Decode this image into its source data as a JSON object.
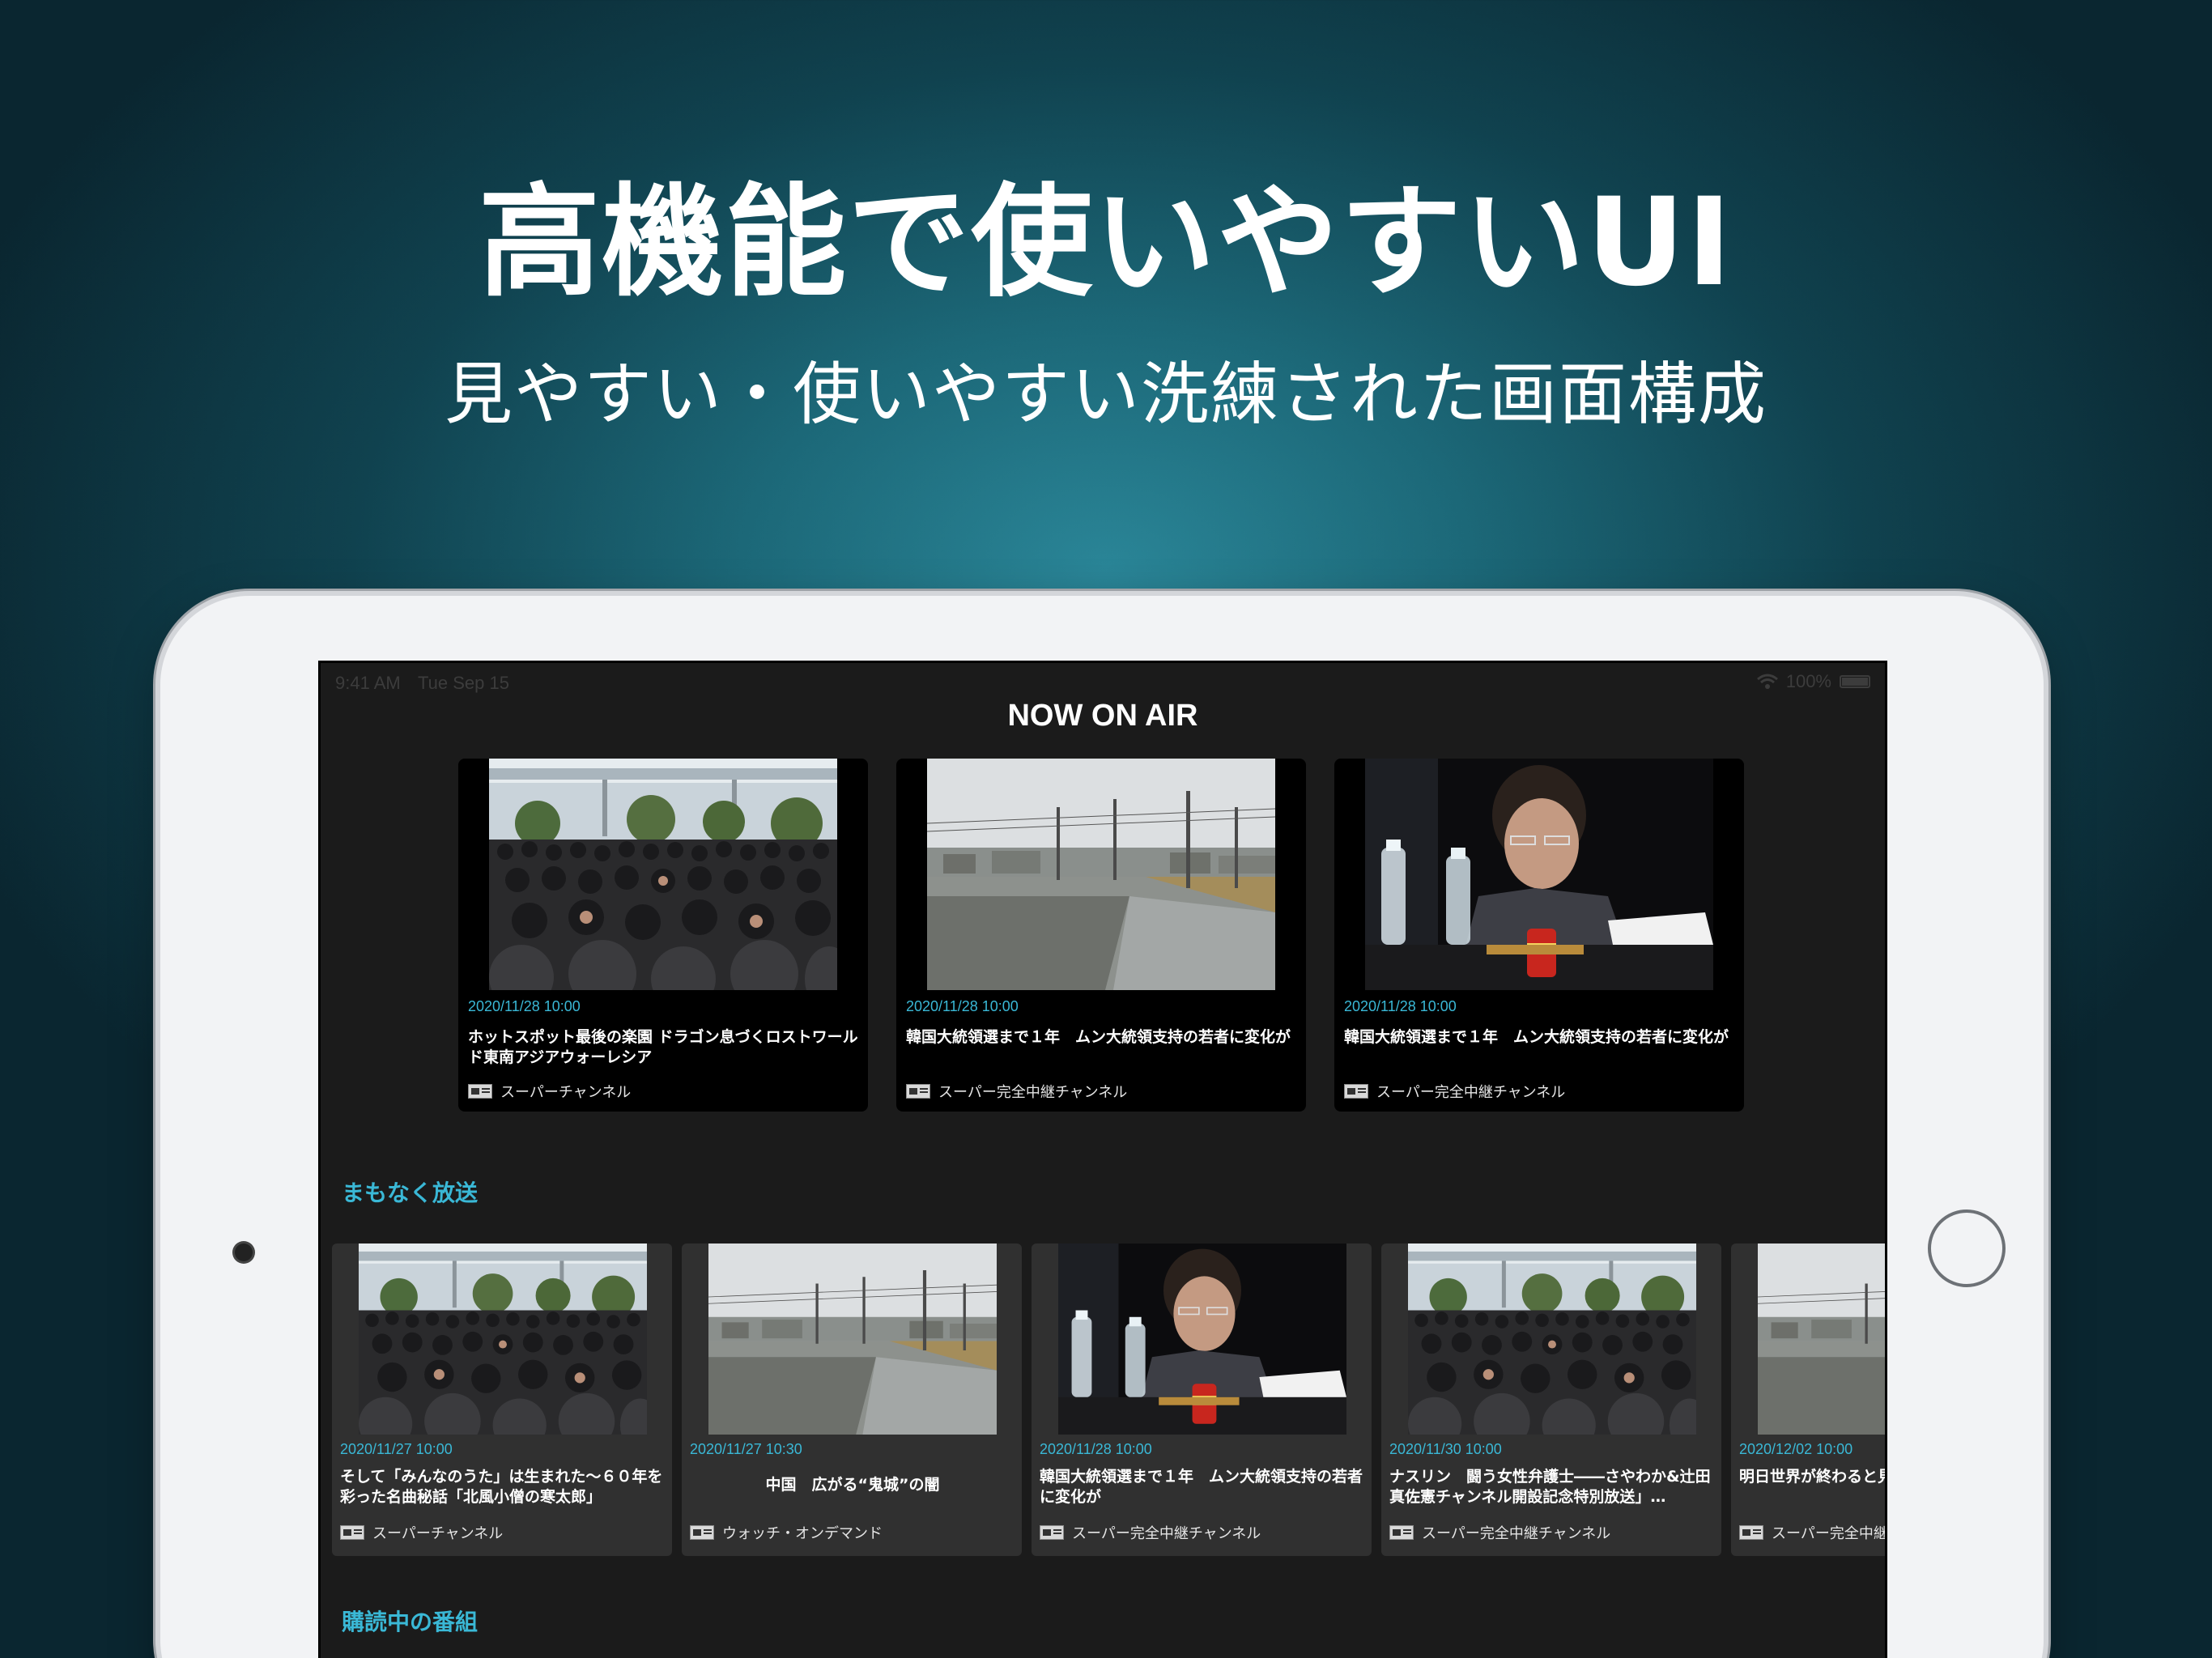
{
  "headline": "高機能で使いやすいUI",
  "subheadline": "見やすい・使いやすい洗練された画面構成",
  "status_bar": {
    "time": "9:41 AM",
    "date": "Tue Sep 15",
    "battery": "100%"
  },
  "screen_title": "NOW ON AIR",
  "now_on_air": [
    {
      "date": "2020/11/28 10:00",
      "title": "ホットスポット最後の楽園 ドラゴン息づくロストワールド東南アジアウォーレシア",
      "channel": "スーパーチャンネル",
      "image": "crowd"
    },
    {
      "date": "2020/11/28 10:00",
      "title": "韓国大統領選まで１年　ムン大統領支持の若者に変化が",
      "channel": "スーパー完全中継チャンネル",
      "image": "flooded-town"
    },
    {
      "date": "2020/11/28 10:00",
      "title": "韓国大統領選まで１年　ムン大統領支持の若者に変化が",
      "channel": "スーパー完全中継チャンネル",
      "image": "man-at-table"
    }
  ],
  "sections": {
    "coming_soon": "まもなく放送",
    "subscribed": "購読中の番組"
  },
  "coming_soon": [
    {
      "date": "2020/11/27 10:00",
      "title": "そして「みんなのうた」は生まれた〜６０年を彩った名曲秘話「北風小僧の寒太郎」",
      "channel": "スーパーチャンネル",
      "image": "crowd"
    },
    {
      "date": "2020/11/27 10:30",
      "title": "中国　広がる“鬼城”の闇",
      "channel": "ウォッチ・オンデマンド",
      "image": "flooded-town"
    },
    {
      "date": "2020/11/28 10:00",
      "title": "韓国大統領選まで１年　ムン大統領支持の若者に変化が",
      "channel": "スーパー完全中継チャンネル",
      "image": "man-at-table"
    },
    {
      "date": "2020/11/30 10:00",
      "title": "ナスリン　闘う女性弁護士――さやわか&辻田真佐憲チャンネル開設記念特別放送」…",
      "channel": "スーパー完全中継チャンネル",
      "image": "crowd"
    },
    {
      "date": "2020/12/02 10:00",
      "title": "明日世界が終わると見ぬ頂へ」",
      "channel": "スーパー完全中継",
      "image": "flooded-town"
    }
  ],
  "colors": {
    "accent": "#3ab8d6",
    "screen_bg": "#1b1b1b",
    "card_bg": "#000000",
    "small_card_bg": "#303030"
  }
}
